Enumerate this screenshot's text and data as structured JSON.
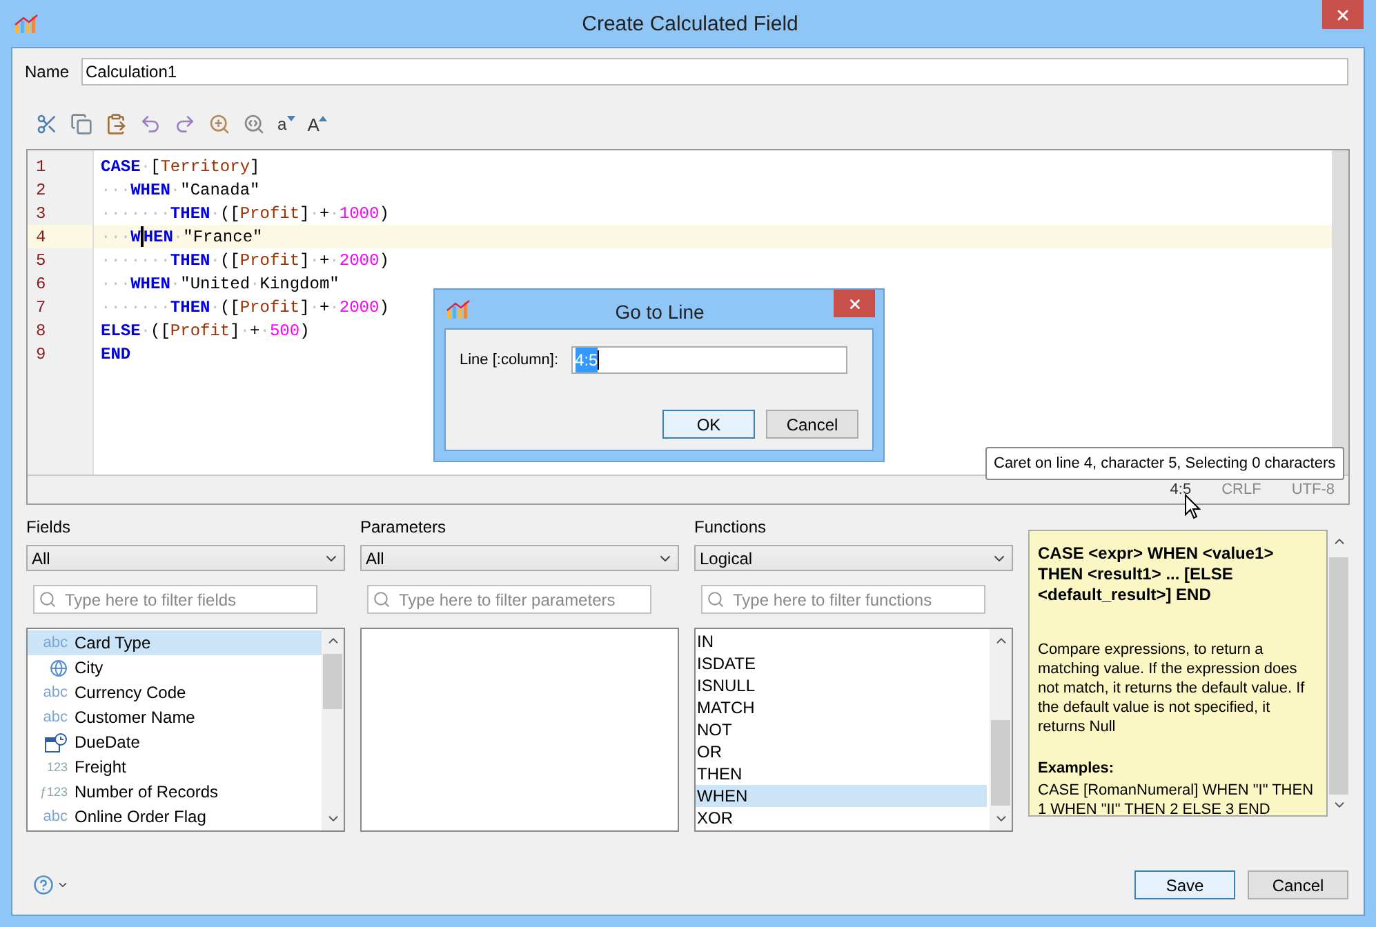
{
  "window": {
    "title": "Create Calculated Field"
  },
  "name_field": {
    "label": "Name",
    "value": "Calculation1"
  },
  "toolbar": [
    {
      "kind": "cut"
    },
    {
      "kind": "copy"
    },
    {
      "kind": "paste"
    },
    {
      "kind": "undo"
    },
    {
      "kind": "redo"
    },
    {
      "kind": "find"
    },
    {
      "kind": "replace"
    },
    {
      "kind": "lower",
      "label": "a"
    },
    {
      "kind": "upper",
      "label": "A"
    }
  ],
  "editor": {
    "lines": [
      {
        "number": "1",
        "current": false,
        "tokens": [
          {
            "kind": "kw",
            "text": "CASE"
          },
          {
            "kind": "ws",
            "text": "·"
          },
          {
            "kind": "plain",
            "text": "["
          },
          {
            "kind": "field",
            "text": "Territory"
          },
          {
            "kind": "plain",
            "text": "]"
          }
        ]
      },
      {
        "number": "2",
        "current": false,
        "tokens": [
          {
            "kind": "ws",
            "text": "···"
          },
          {
            "kind": "kw",
            "text": "WHEN"
          },
          {
            "kind": "ws",
            "text": "·"
          },
          {
            "kind": "plain",
            "text": "\"Canada\""
          }
        ]
      },
      {
        "number": "3",
        "current": false,
        "tokens": [
          {
            "kind": "ws",
            "text": "·······"
          },
          {
            "kind": "kw",
            "text": "THEN"
          },
          {
            "kind": "ws",
            "text": "·"
          },
          {
            "kind": "plain",
            "text": "(["
          },
          {
            "kind": "field",
            "text": "Profit"
          },
          {
            "kind": "plain",
            "text": "]"
          },
          {
            "kind": "ws",
            "text": "·"
          },
          {
            "kind": "plain",
            "text": "+"
          },
          {
            "kind": "ws",
            "text": "·"
          },
          {
            "kind": "num",
            "text": "1000"
          },
          {
            "kind": "plain",
            "text": ")"
          }
        ]
      },
      {
        "number": "4",
        "current": true,
        "tokens": [
          {
            "kind": "ws",
            "text": "···"
          },
          {
            "kind": "kw",
            "text": "W",
            "caret_after": true
          },
          {
            "kind": "kw",
            "text": "HEN"
          },
          {
            "kind": "ws",
            "text": "·"
          },
          {
            "kind": "plain",
            "text": "\"France\""
          }
        ]
      },
      {
        "number": "5",
        "current": false,
        "tokens": [
          {
            "kind": "ws",
            "text": "·······"
          },
          {
            "kind": "kw",
            "text": "THEN"
          },
          {
            "kind": "ws",
            "text": "·"
          },
          {
            "kind": "plain",
            "text": "(["
          },
          {
            "kind": "field",
            "text": "Profit"
          },
          {
            "kind": "plain",
            "text": "]"
          },
          {
            "kind": "ws",
            "text": "·"
          },
          {
            "kind": "plain",
            "text": "+"
          },
          {
            "kind": "ws",
            "text": "·"
          },
          {
            "kind": "num",
            "text": "2000"
          },
          {
            "kind": "plain",
            "text": ")"
          }
        ]
      },
      {
        "number": "6",
        "current": false,
        "tokens": [
          {
            "kind": "ws",
            "text": "···"
          },
          {
            "kind": "kw",
            "text": "WHEN"
          },
          {
            "kind": "ws",
            "text": "·"
          },
          {
            "kind": "plain",
            "text": "\"United"
          },
          {
            "kind": "ws",
            "text": "·"
          },
          {
            "kind": "plain",
            "text": "Kingdom\""
          }
        ]
      },
      {
        "number": "7",
        "current": false,
        "tokens": [
          {
            "kind": "ws",
            "text": "·······"
          },
          {
            "kind": "kw",
            "text": "THEN"
          },
          {
            "kind": "ws",
            "text": "·"
          },
          {
            "kind": "plain",
            "text": "(["
          },
          {
            "kind": "field",
            "text": "Profit"
          },
          {
            "kind": "plain",
            "text": "]"
          },
          {
            "kind": "ws",
            "text": "·"
          },
          {
            "kind": "plain",
            "text": "+"
          },
          {
            "kind": "ws",
            "text": "·"
          },
          {
            "kind": "num",
            "text": "2000"
          },
          {
            "kind": "plain",
            "text": ")"
          }
        ]
      },
      {
        "number": "8",
        "current": false,
        "tokens": [
          {
            "kind": "kw",
            "text": "ELSE"
          },
          {
            "kind": "ws",
            "text": "·"
          },
          {
            "kind": "plain",
            "text": "(["
          },
          {
            "kind": "field",
            "text": "Profit"
          },
          {
            "kind": "plain",
            "text": "]"
          },
          {
            "kind": "ws",
            "text": "·"
          },
          {
            "kind": "plain",
            "text": "+"
          },
          {
            "kind": "ws",
            "text": "·"
          },
          {
            "kind": "num",
            "text": "500"
          },
          {
            "kind": "plain",
            "text": ")"
          }
        ]
      },
      {
        "number": "9",
        "current": false,
        "tokens": [
          {
            "kind": "kw",
            "text": "END"
          }
        ]
      }
    ],
    "status": {
      "position": "4:5",
      "line_ending": "CRLF",
      "encoding": "UTF-8"
    },
    "tooltip": "Caret on line 4, character 5, Selecting 0 characters"
  },
  "goto_dialog": {
    "title": "Go to Line",
    "label": "Line [:column]:",
    "value": "4:5",
    "buttons": [
      {
        "label": "OK",
        "default": true
      },
      {
        "label": "Cancel",
        "default": false
      }
    ]
  },
  "fields": {
    "label": "Fields",
    "filter": "All",
    "placeholder": "Type here to filter fields",
    "items": [
      {
        "kind": "string",
        "type_mark": "abc",
        "label": "Card Type",
        "selected": true
      },
      {
        "kind": "geo",
        "label": "City",
        "selected": false
      },
      {
        "kind": "string",
        "type_mark": "abc",
        "label": "Currency Code",
        "selected": false
      },
      {
        "kind": "string",
        "type_mark": "abc",
        "label": "Customer Name",
        "selected": false
      },
      {
        "kind": "date",
        "label": "DueDate",
        "selected": false
      },
      {
        "kind": "number",
        "type_mark": "123",
        "label": "Freight",
        "selected": false
      },
      {
        "kind": "calc",
        "type_mark": "ƒ123",
        "label": "Number of Records",
        "selected": false
      },
      {
        "kind": "string",
        "type_mark": "abc",
        "label": "Online Order Flag",
        "selected": false
      }
    ]
  },
  "parameters": {
    "label": "Parameters",
    "filter": "All",
    "placeholder": "Type here to filter parameters"
  },
  "functions": {
    "label": "Functions",
    "filter": "Logical",
    "placeholder": "Type here to filter functions",
    "items": [
      {
        "label": "IN",
        "selected": false
      },
      {
        "label": "ISDATE",
        "selected": false
      },
      {
        "label": "ISNULL",
        "selected": false
      },
      {
        "label": "MATCH",
        "selected": false
      },
      {
        "label": "NOT",
        "selected": false
      },
      {
        "label": "OR",
        "selected": false
      },
      {
        "label": "THEN",
        "selected": false
      },
      {
        "label": "WHEN",
        "selected": true
      },
      {
        "label": "XOR",
        "selected": false
      }
    ]
  },
  "help": {
    "syntax": "CASE <expr> WHEN <value1> THEN <result1> ... [ELSE <default_result>] END",
    "description": "Compare expressions, to return a matching value. If the expression does not match, it returns the default value. If the default value is not specified, it returns Null",
    "examples_heading": "Examples:",
    "example": "CASE [RomanNumeral] WHEN \"I\" THEN 1 WHEN \"II\" THEN 2 ELSE 3 END"
  },
  "buttons": [
    {
      "label": "Save",
      "default": true
    },
    {
      "label": "Cancel",
      "default": false
    }
  ]
}
